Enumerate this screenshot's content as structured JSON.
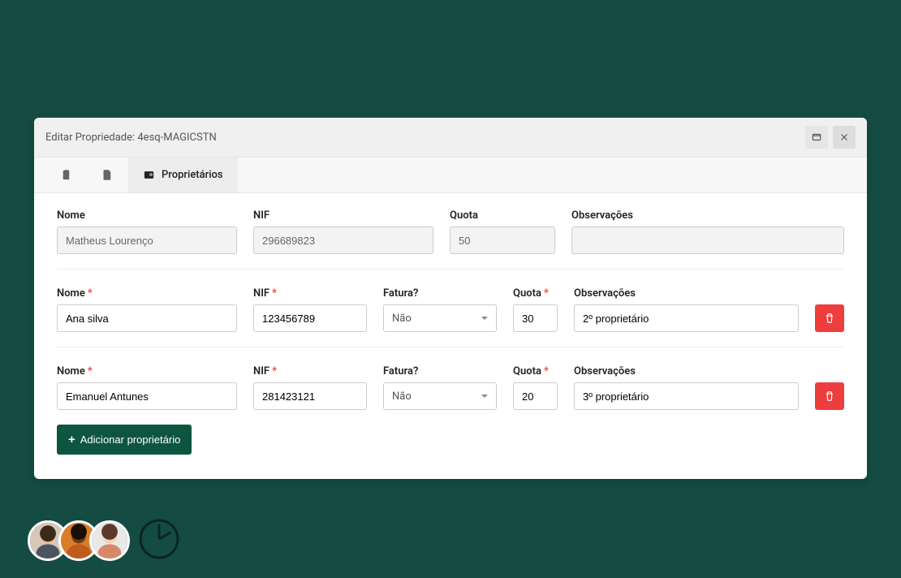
{
  "modal": {
    "title": "Editar Propriedade: 4esq-MAGICSTN"
  },
  "tabs": {
    "active_label": "Proprietários"
  },
  "labels": {
    "nome": "Nome",
    "nif": "NIF",
    "quota": "Quota",
    "obs": "Observações",
    "fatura": "Fatura?"
  },
  "primary_owner": {
    "nome": "Matheus Lourenço",
    "nif": "296689823",
    "quota": "50",
    "obs": ""
  },
  "owners": [
    {
      "nome": "Ana silva",
      "nif": "123456789",
      "fatura": "Não",
      "quota": "30",
      "obs": "2º proprietário"
    },
    {
      "nome": "Emanuel Antunes",
      "nif": "281423121",
      "fatura": "Não",
      "quota": "20",
      "obs": "3º proprietário"
    }
  ],
  "buttons": {
    "add_owner": "Adicionar proprietário"
  }
}
